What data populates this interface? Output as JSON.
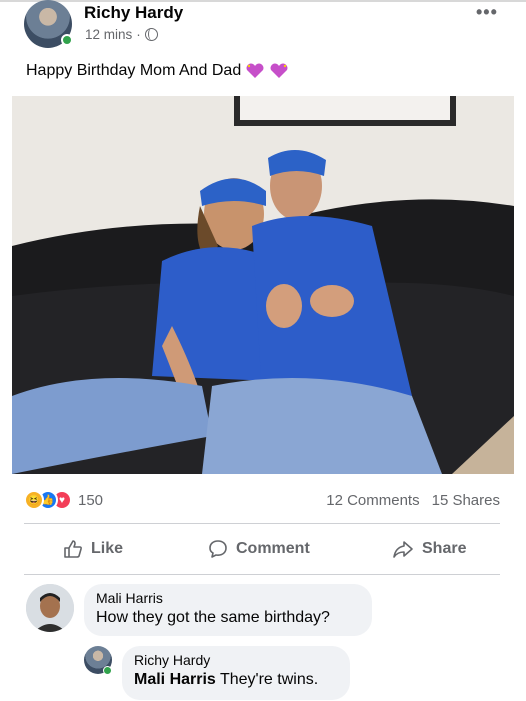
{
  "post": {
    "author": "Richy Hardy",
    "time": "12 mins",
    "separator": "·",
    "text": "Happy Birthday Mom And Dad",
    "more_icon": "more-options-icon",
    "privacy_icon": "globe-icon"
  },
  "stats": {
    "reaction_count": "150",
    "comments": "12 Comments",
    "shares": "15 Shares",
    "reactions": [
      "haha",
      "like",
      "love"
    ]
  },
  "actions": {
    "like": "Like",
    "comment": "Comment",
    "share": "Share"
  },
  "comments": [
    {
      "author": "Mali Harris",
      "text": "How they got the same birthday?"
    },
    {
      "author": "Richy Hardy",
      "mention": "Mali Harris",
      "text": "They're twins."
    }
  ],
  "colors": {
    "accent": "#1877f2",
    "muted_text": "#65676b",
    "bubble": "#f0f2f5",
    "online": "#31a24c"
  }
}
